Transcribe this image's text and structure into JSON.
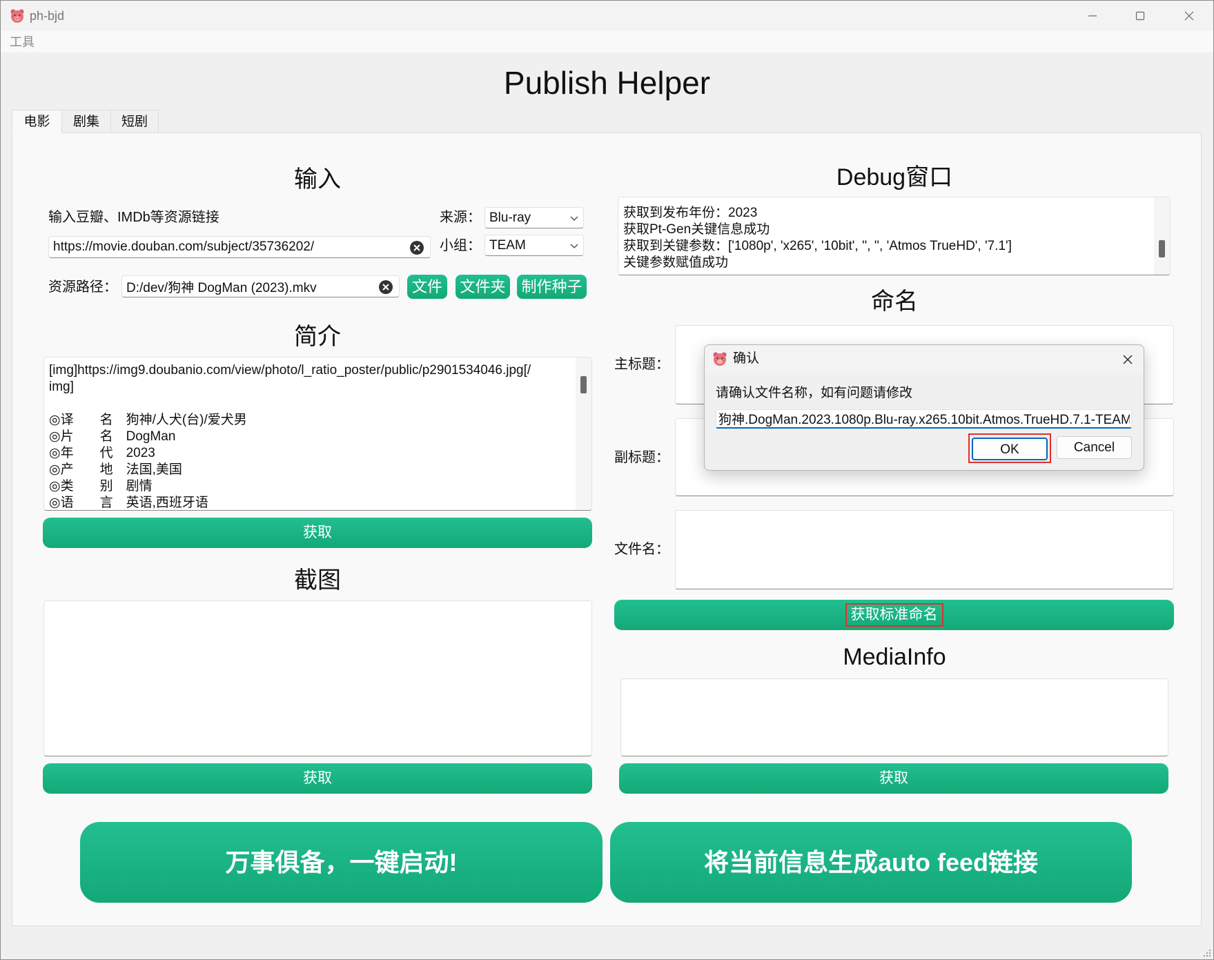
{
  "window": {
    "title": "ph-bjd"
  },
  "menu": {
    "tools": "工具"
  },
  "app_title": "Publish Helper",
  "tabs": [
    {
      "label": "电影",
      "selected": true
    },
    {
      "label": "剧集"
    },
    {
      "label": "短剧"
    }
  ],
  "input": {
    "heading": "输入",
    "link_label": "输入豆瓣、IMDb等资源链接",
    "link_value": "https://movie.douban.com/subject/35736202/",
    "source_label": "来源：",
    "source_value": "Blu-ray",
    "group_label": "小组：",
    "group_value": "TEAM",
    "path_label": "资源路径：",
    "path_value": "D:/dev/狗神 DogMan (2023).mkv",
    "file_button": "文件",
    "folder_button": "文件夹",
    "torrent_button": "制作种子"
  },
  "intro": {
    "heading": "简介",
    "lines": [
      "[img]https://img9.doubanio.com/view/photo/l_ratio_poster/public/p2901534046.jpg[/",
      "img]",
      "",
      "◎译　　名　狗神/人犬(台)/爱犬男",
      "◎片　　名　DogMan",
      "◎年　　代　2023",
      "◎产　　地　法国,美国",
      "◎类　　别　剧情",
      "◎语　　言　英语,西班牙语"
    ],
    "fetch_button": "获取"
  },
  "screenshot": {
    "heading": "截图",
    "fetch_button": "获取"
  },
  "debug": {
    "heading": "Debug窗口",
    "lines": [
      "获取到发布年份：2023",
      "获取Pt-Gen关键信息成功",
      "获取到关键参数：['1080p', 'x265', '10bit', '', '', 'Atmos TrueHD', '7.1']",
      "关键参数赋值成功"
    ]
  },
  "naming": {
    "heading": "命名",
    "main_title_label": "主标题：",
    "subtitle_label": "副标题：",
    "filename_label": "文件名：",
    "fetch_button": "获取标准命名"
  },
  "mediainfo": {
    "heading": "MediaInfo",
    "fetch_button": "获取"
  },
  "actions": {
    "launch": "万事俱备，一键启动!",
    "auto_feed": "将当前信息生成auto feed链接"
  },
  "dialog": {
    "title": "确认",
    "message": "请确认文件名称，如有问题请修改",
    "filename": "狗神.DogMan.2023.1080p.Blu-ray.x265.10bit.Atmos.TrueHD.7.1-TEAM",
    "ok": "OK",
    "cancel": "Cancel"
  },
  "colors": {
    "accent": "#19b384",
    "highlight": "#e0302e",
    "focus": "#0067c0"
  },
  "icons": [
    "pig-icon",
    "minimize-icon",
    "maximize-icon",
    "close-icon",
    "clear-icon",
    "chevron-down-icon",
    "size-grip-icon"
  ]
}
